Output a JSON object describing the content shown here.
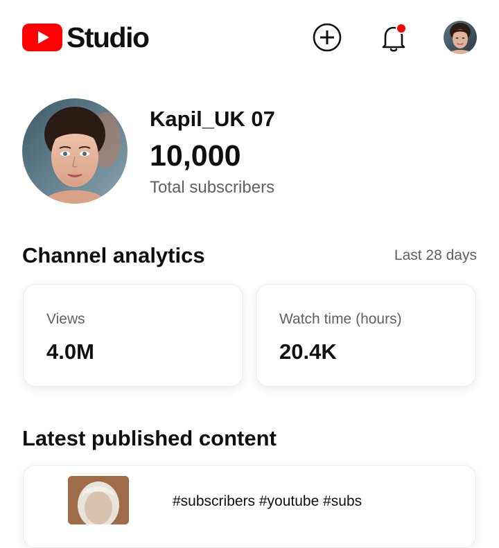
{
  "header": {
    "app_name": "Studio",
    "icons": [
      "youtube-logo-icon",
      "create-plus-icon",
      "notification-bell-icon",
      "profile-avatar"
    ],
    "notification_dot_color": "#ff0000",
    "brand_color": "#ff0000"
  },
  "channel": {
    "name": "Kapil_UK 07",
    "subscriber_count": "10,000",
    "subscriber_label": "Total subscribers"
  },
  "analytics": {
    "title": "Channel analytics",
    "period": "Last 28 days",
    "cards": [
      {
        "label": "Views",
        "value": "4.0M"
      },
      {
        "label": "Watch time (hours)",
        "value": "20.4K"
      }
    ]
  },
  "latest": {
    "title": "Latest published content",
    "item_text": "#subscribers #youtube #subs"
  }
}
